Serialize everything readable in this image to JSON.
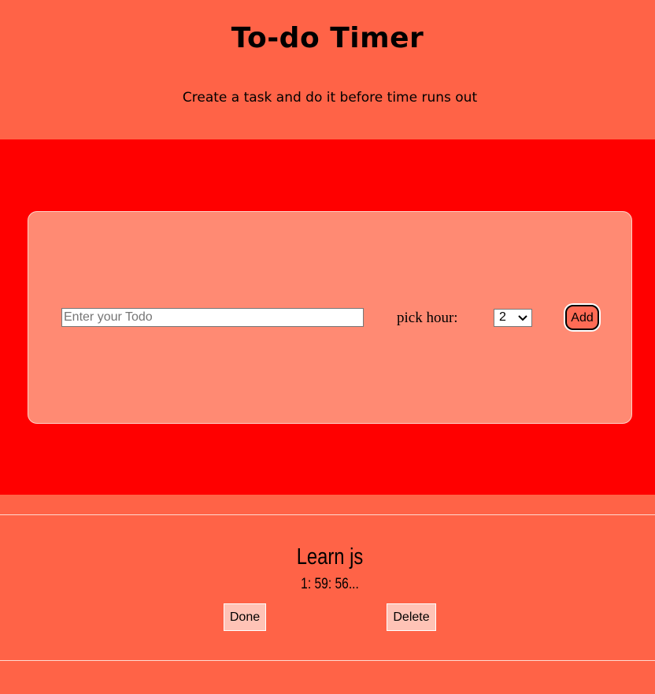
{
  "header": {
    "title": "To-do Timer",
    "subtitle": "Create a task and do it before time runs out"
  },
  "form": {
    "input_placeholder": "Enter your Todo",
    "input_value": "",
    "pick_hour_label": "pick hour:",
    "hour_selected": "2",
    "add_label": "Add"
  },
  "tasks": [
    {
      "title": "Learn js",
      "timer": "1: 59: 56...",
      "done_label": "Done",
      "delete_label": "Delete"
    }
  ],
  "colors": {
    "page_background": "#ff6347",
    "band_background": "#ff0000",
    "card_background": "#ff8a73",
    "task_button_background": "#ffc3b6"
  },
  "icons": {
    "select_chevron": "chevron-down-icon"
  }
}
